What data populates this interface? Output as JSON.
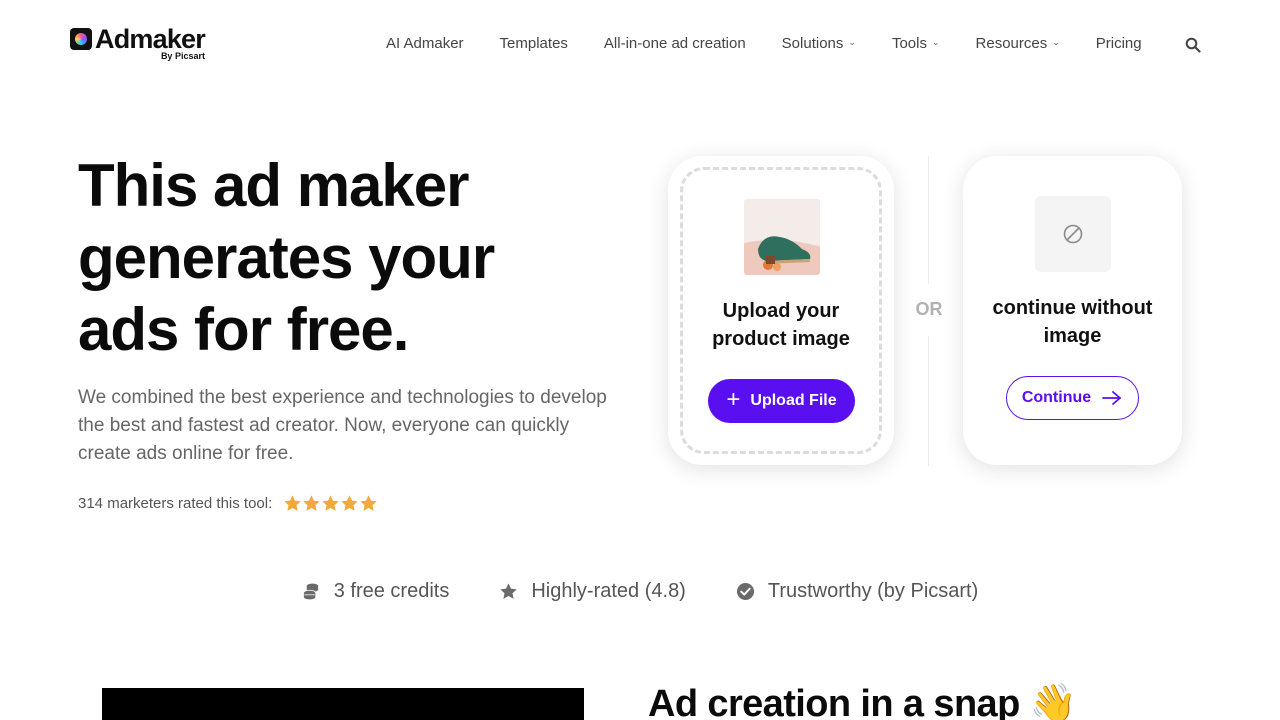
{
  "brand": {
    "name": "Admaker",
    "byline": "By Picsart"
  },
  "nav": {
    "items": [
      {
        "label": "AI Admaker",
        "has_dropdown": false
      },
      {
        "label": "Templates",
        "has_dropdown": false
      },
      {
        "label": "All-in-one ad creation",
        "has_dropdown": false
      },
      {
        "label": "Solutions",
        "has_dropdown": true
      },
      {
        "label": "Tools",
        "has_dropdown": true
      },
      {
        "label": "Resources",
        "has_dropdown": true
      },
      {
        "label": "Pricing",
        "has_dropdown": false
      }
    ],
    "search_icon": "search-icon"
  },
  "hero": {
    "title_lines": [
      "This ad maker",
      "generates your",
      "ads for free."
    ],
    "subtitle": "We combined the best experience and technologies to develop the best and fastest ad creator. Now, everyone can quickly create ads online for free.",
    "rating_text": "314 marketers rated this tool:",
    "stars": 5
  },
  "upload_card": {
    "title_lines": [
      "Upload your",
      "product image"
    ],
    "button_label": "Upload File"
  },
  "divider": {
    "label": "OR"
  },
  "continue_card": {
    "title_lines": [
      "continue without",
      "image"
    ],
    "button_label": "Continue"
  },
  "features": [
    {
      "icon": "coins-icon",
      "label": "3 free credits"
    },
    {
      "icon": "star-icon",
      "label": "Highly-rated (4.8)"
    },
    {
      "icon": "check-circle-icon",
      "label": "Trustworthy (by Picsart)"
    }
  ],
  "section": {
    "title": "Ad creation in a snap 👋"
  },
  "colors": {
    "accent": "#5a0ff0",
    "star": "#f2a93b",
    "text_muted": "#666666"
  }
}
